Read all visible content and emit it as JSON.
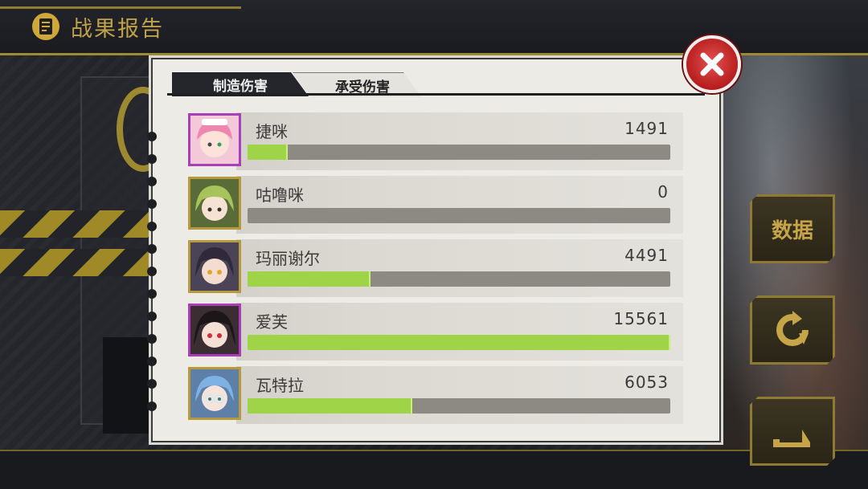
{
  "header": {
    "title": "战果报告",
    "icon": "report-icon"
  },
  "dialog": {
    "tabs": [
      {
        "label": "制造伤害",
        "active": true
      },
      {
        "label": "承受伤害",
        "active": false
      }
    ],
    "rows": [
      {
        "name": "捷咪",
        "value": "1491",
        "fill": 0.095,
        "frame": "purple"
      },
      {
        "name": "咕噜咪",
        "value": "0",
        "fill": 0.0,
        "frame": "gold"
      },
      {
        "name": "玛丽谢尔",
        "value": "4491",
        "fill": 0.29,
        "frame": "gold"
      },
      {
        "name": "爱芙",
        "value": "15561",
        "fill": 1.0,
        "frame": "purple"
      },
      {
        "name": "瓦特拉",
        "value": "6053",
        "fill": 0.39,
        "frame": "gold"
      }
    ],
    "close_icon": "close-icon"
  },
  "side_buttons": [
    {
      "label": "数据",
      "icon": ""
    },
    {
      "label": "",
      "icon": "replay-icon"
    },
    {
      "label": "",
      "icon": "next-arrow-icon"
    }
  ],
  "colors": {
    "bar_fill": "#9fd449",
    "bar_track": "#8c8a83",
    "accent_gold": "#b79a3c",
    "close_red": "#c72a2a"
  }
}
